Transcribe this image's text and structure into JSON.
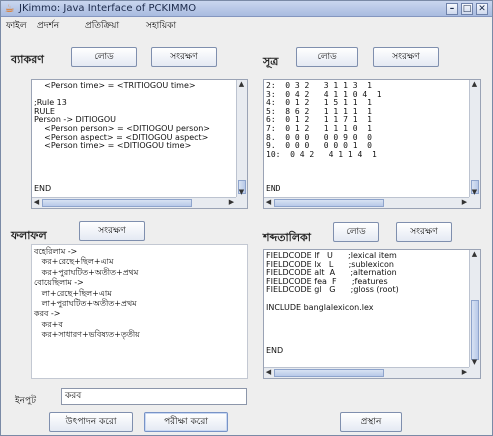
{
  "window": {
    "title": "JKimmo: Java Interface of PCKIMMO"
  },
  "menu": {
    "items": [
      "ফাইল",
      "প্রদর্শন",
      "প্রতিক্রিয়া",
      "সহায়িকা"
    ]
  },
  "grammar": {
    "heading": "ব্যাকরণ",
    "load_label": "লোড",
    "edit_label": "সংরক্ষণ",
    "lines": [
      "    <Person time> = <TRITIOGOU time>",
      "",
      ";Rule 13",
      "RULE",
      "Person -> DITIOGOU",
      "    <Person person> = <DITIOGOU person>",
      "    <Person aspect> = <DITIOGOU aspect>",
      "    <Person time> = <DITIOGOU time>",
      "",
      "",
      "",
      "",
      "END"
    ]
  },
  "rules": {
    "heading": "সূত্র",
    "load_label": "লোড",
    "edit_label": "সংরক্ষণ",
    "lines": [
      "2:  0 3 2   3 1 1 3  1",
      "3:  0 4 2   4 1 1 0 4  1",
      "4:  0 1 2   1 5 1 1  1",
      "5:  8 6 2   1 1 1 1  1",
      "6:  0 1 2   1 1 7 1  1",
      "7:  0 1 2   1 1 1 0  1",
      "8.  0 0 0   0 0 9 0  0",
      "9.  0 0 0   0 0 0 1  0",
      "10:  0 4 2   4 1 1 4  1",
      "",
      "",
      "",
      "END"
    ]
  },
  "output": {
    "heading": "ফলাফল",
    "edit_label": "সংরক্ষণ",
    "lines": [
      "বহেরিলাম ->",
      "   কর+রেছে+ছিল+এাম",
      "   কর+পুরাঘটিত+অতীত+প্রথম",
      "বোয়েছিলাম ->",
      "   লা+রেছে+ছিল+এাম",
      "   লা+পুরাঘটিত+অতীত+প্রথম",
      "করব ->",
      "   কর+ব",
      "   কর+সাধারণ+ভবিষ্যত+তৃতীয়"
    ]
  },
  "lexicon": {
    "heading": "শব্দতালিকা",
    "load_label": "লোড",
    "edit_label": "সংরক্ষণ",
    "lines": [
      "FIELDCODE lf   U      ;lexical item",
      "FIELDCODE lx   L      ;sublexicon",
      "FIELDCODE alt  A      ;alternation",
      "FIELDCODE fea  F      ;features",
      "FIELDCODE gl   G      ;gloss (root)",
      "",
      "INCLUDE banglalexicon.lex",
      "",
      "",
      "",
      "",
      "END"
    ]
  },
  "input": {
    "label": "ইনপুট",
    "value": "করব"
  },
  "actions": {
    "generate_label": "উৎপাদন করো",
    "recognize_label": "পরীক্ষা করো",
    "quit_label": "প্রস্থান"
  },
  "title_controls": {
    "minimize": "–",
    "maximize": "□",
    "close": "✕"
  },
  "app_icon": "coffee-cup-icon",
  "colors": {
    "titlebar": "#b9c8e8",
    "window_bg": "#eeeeee"
  }
}
